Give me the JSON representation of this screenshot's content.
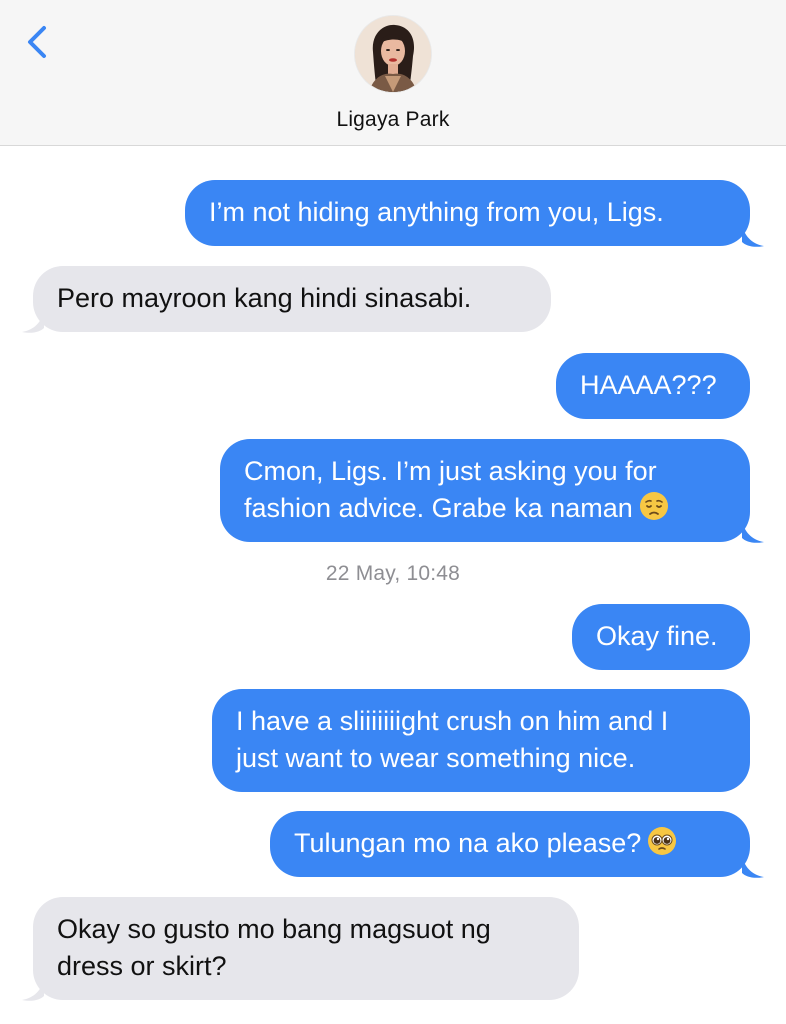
{
  "header": {
    "contact_name": "Ligaya Park"
  },
  "timestamp": "22 May, 10:48",
  "messages": [
    {
      "text": "I’m not hiding anything from you, Ligs."
    },
    {
      "text": "Pero mayroon kang hindi sinasabi."
    },
    {
      "text": "HAAAA???"
    },
    {
      "line1": "Cmon, Ligs. I’m just asking you for",
      "line2": "fashion advice. Grabe ka naman"
    },
    {
      "text": "Okay fine."
    },
    {
      "line1": "I have a sliiiiiiight crush on him and I",
      "line2": "just want to wear something nice."
    },
    {
      "text": "Tulungan mo na ako please?"
    },
    {
      "line1": "Okay so gusto mo bang magsuot ng",
      "line2": "dress or skirt?"
    }
  ],
  "colors": {
    "sent_bubble": "#3a86f4",
    "received_bubble": "#e6e6eb",
    "back_arrow": "#3a86f4"
  },
  "icons": {
    "back": "chevron-left-icon",
    "pensive_emoji": "pensive-face-icon",
    "pleading_emoji": "pleading-face-icon"
  }
}
